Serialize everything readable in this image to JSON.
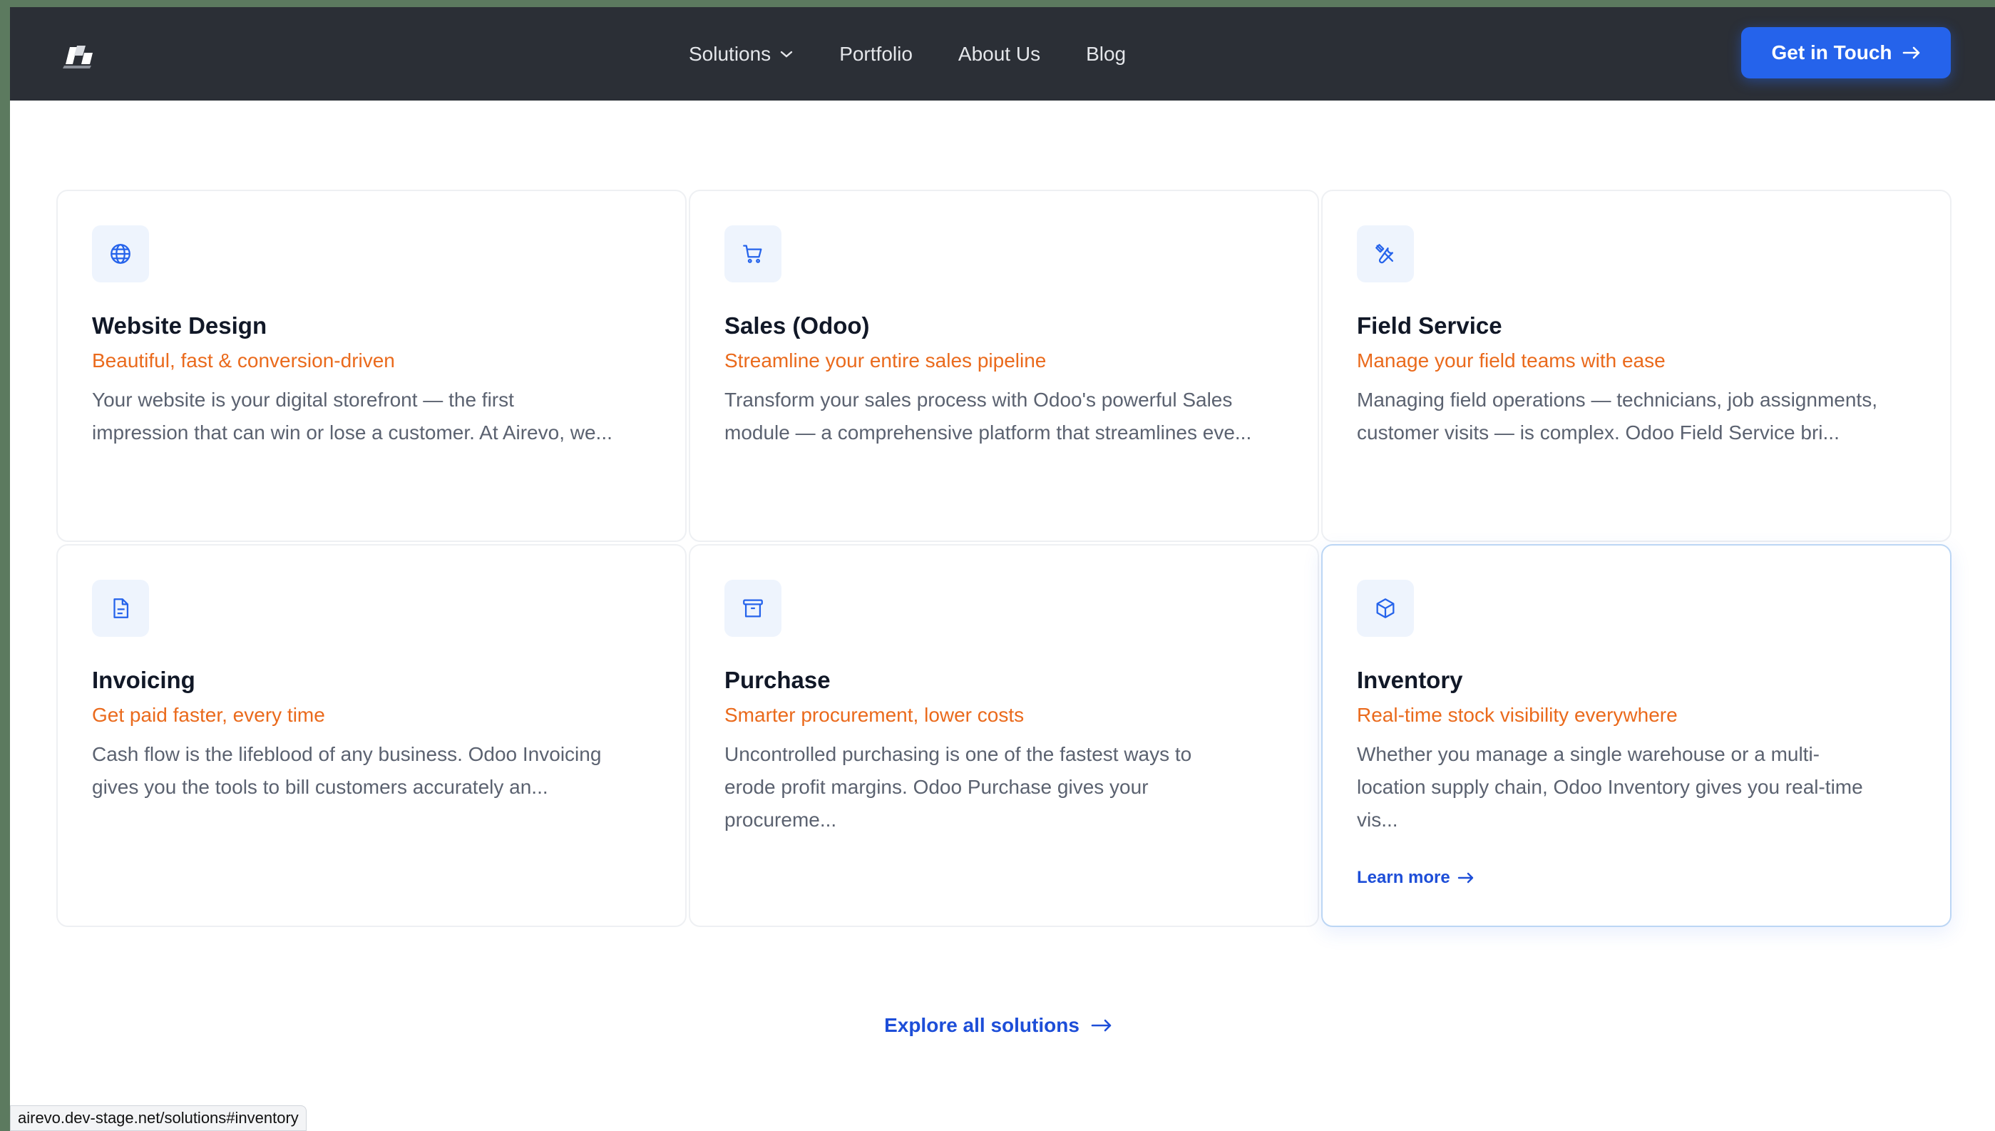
{
  "nav": {
    "links": [
      "Solutions",
      "Portfolio",
      "About Us",
      "Blog"
    ],
    "cta_label": "Get in Touch"
  },
  "cards": [
    {
      "icon": "globe-icon",
      "title": "Website Design",
      "subtitle": "Beautiful, fast & conversion-driven",
      "desc1": "Your website is your digital storefront — the first",
      "desc2": "impression that can win or lose a customer. At Airevo, we..."
    },
    {
      "icon": "cart-icon",
      "title": "Sales (Odoo)",
      "subtitle": "Streamline your entire sales pipeline",
      "desc1": "Transform your sales process with Odoo's powerful Sales",
      "desc2": "module — a comprehensive platform that streamlines eve..."
    },
    {
      "icon": "tools-icon",
      "title": "Field Service",
      "subtitle": "Manage your field teams with ease",
      "desc1": "Managing field operations — technicians, job assignments,",
      "desc2": "customer visits — is complex. Odoo Field Service bri..."
    },
    {
      "icon": "document-icon",
      "title": "Invoicing",
      "subtitle": "Get paid faster, every time",
      "desc1": "Cash flow is the lifeblood of any business. Odoo Invoicing",
      "desc2": "gives you the tools to bill customers accurately an..."
    },
    {
      "icon": "archive-icon",
      "title": "Purchase",
      "subtitle": "Smarter procurement, lower costs",
      "desc1": "Uncontrolled purchasing is one of the fastest ways to",
      "desc2": "erode profit margins. Odoo Purchase gives your",
      "desc3": "procureme..."
    },
    {
      "icon": "box-icon",
      "title": "Inventory",
      "subtitle": "Real-time stock visibility everywhere",
      "desc1": "Whether you manage a single warehouse or a multi-",
      "desc2": "location supply chain, Odoo Inventory gives you real-time",
      "desc3": "vis...",
      "link": "Learn more"
    }
  ],
  "explore_label": "Explore all solutions",
  "status_url": "airevo.dev-stage.net/solutions#inventory",
  "colors": {
    "accent": "#2563eb",
    "subtitle": "#ea6a1c",
    "nav_bg": "#2b2f36"
  }
}
